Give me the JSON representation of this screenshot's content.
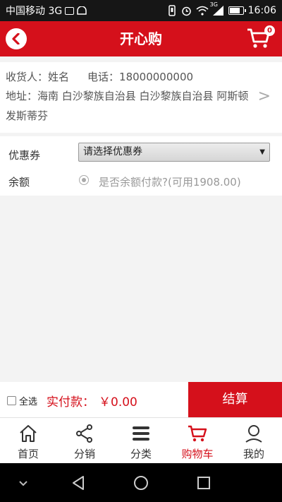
{
  "status_bar": {
    "carrier": "中国移动 3G",
    "time": "16:06",
    "net": "3G"
  },
  "header": {
    "title": "开心购",
    "cart_count": "0"
  },
  "address": {
    "consignee_label": "收货人：",
    "consignee_name": "姓名",
    "phone_label": "电话：",
    "phone": "18000000000",
    "address_label": "地址：",
    "address_text": "海南 白沙黎族自治县 白沙黎族自治县 阿斯顿发斯蒂芬"
  },
  "coupon": {
    "label": "优惠券",
    "selected": "请选择优惠券"
  },
  "balance": {
    "label": "余额",
    "text": "是否余额付款?(可用1908.00)"
  },
  "checkout": {
    "select_all": "全选",
    "pay_label": "实付款：",
    "pay_amount": "￥0.00",
    "settle": "结算"
  },
  "tabs": [
    {
      "label": "首页",
      "icon": "home-icon"
    },
    {
      "label": "分销",
      "icon": "share-icon"
    },
    {
      "label": "分类",
      "icon": "menu-icon"
    },
    {
      "label": "购物车",
      "icon": "cart-icon"
    },
    {
      "label": "我的",
      "icon": "user-icon"
    }
  ],
  "colors": {
    "brand": "#d5101b"
  }
}
